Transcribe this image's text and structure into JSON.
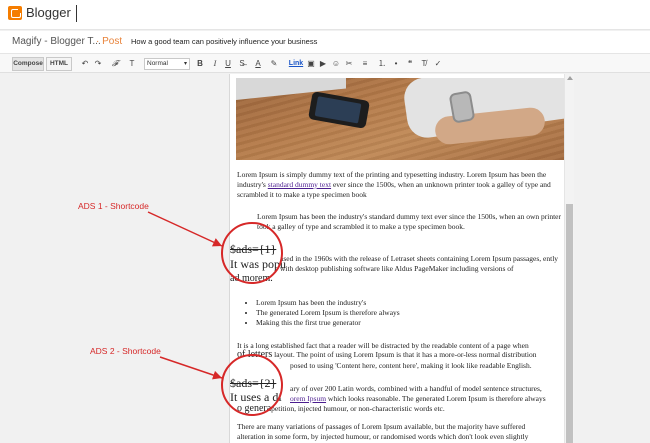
{
  "topbar": {
    "brand": "Blogger"
  },
  "titlerow": {
    "blog_name": "Magify - Blogger T...",
    "post_tag": "· Post",
    "post_title": "How a good team can positively influence your business"
  },
  "toolbar": {
    "compose": "Compose",
    "html": "HTML",
    "format_value": "Normal",
    "link": "Link",
    "buttons": {
      "undo": "↶",
      "redo": "↷",
      "font": "𝓕",
      "size": "T",
      "bold": "B",
      "italic": "I",
      "underline": "U",
      "strike": "S̶",
      "textcolor": "A",
      "highlight": "✎",
      "image": "▣",
      "video": "▶",
      "emoji": "☺",
      "jump": "✂",
      "align": "≡",
      "numlist": "⒈",
      "bullist": "•",
      "quote": "❝",
      "clear": "T̸",
      "spell": "✓"
    }
  },
  "editor": {
    "p1_a": "Lorem Ipsum is simply dummy text of the printing and typesetting industry. Lorem Ipsum has been the industry's ",
    "p1_link": "standard dummy text",
    "p1_b": " ever since the 1500s, when an unknown printer took a galley of type and scrambled it to make a type specimen book",
    "p2": "Lorem Ipsum has been the industry's standard dummy text ever since the 1500s, when an own printer took a galley of type and scrambled it to make a type specimen book.",
    "shortcode1": "$ads={1}",
    "partial1": "It was popu",
    "p3": "ased in the 1960s with the release of Letraset sheets containing Lorem Ipsum passages, ently with desktop publishing software like Aldus PageMaker including versions of",
    "partial1b": "ad morem.",
    "bullets": [
      "Lorem Ipsum has been the industry's",
      "The generated Lorem Ipsum is therefore always",
      "Making this the first true generator"
    ],
    "p4": "It is a long established fact that a reader will be distracted by the readable content of a page when",
    "p4b_big": "of letters",
    "p4b": " layout. The point of using Lorem Ipsum is that it has a more-or-less normal distribution",
    "p4c": "posed to using 'Content here, content here', making it look like readable English.",
    "shortcode2": "$ads={2}",
    "partial2": "It uses a di",
    "p5a": "ary of over 200 Latin words, combined with a handful of model sentence structures,",
    "p5_link": "orem Ipsum",
    "p5b": " which looks reasonable. The generated Lorem Ipsum is therefore always",
    "p5c_big": "o genera",
    "p5c": "petition, injected humour, or non-characteristic words etc.",
    "p6a": "There are many variations of passages of Lorem Ipsum available, but the majority have suffered",
    "p6b": "alteration in some form, by injected humour, or randomised words which don't look even slightly"
  },
  "annotations": {
    "ads1": "ADS 1 - Shortcode",
    "ads2": "ADS 2 - Shortcode",
    "color": "#d62828"
  }
}
